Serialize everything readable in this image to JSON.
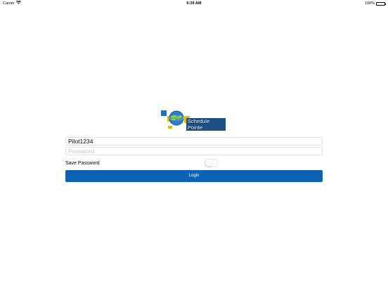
{
  "status_bar": {
    "carrier": "Carrier",
    "time": "6:39 AM",
    "battery_percent": "100%",
    "battery_level": 1.0,
    "battery_color": "#4cd964",
    "wifi_icon": "wifi-icon"
  },
  "logo": {
    "text": "Schedule Pointe",
    "icon": "globe-icon"
  },
  "login": {
    "username_value": "Pilot1234",
    "password_placeholder": "Password",
    "save_password_label": "Save Password",
    "save_password_on": false,
    "button_label": "Login",
    "button_color": "#0d62b5"
  }
}
